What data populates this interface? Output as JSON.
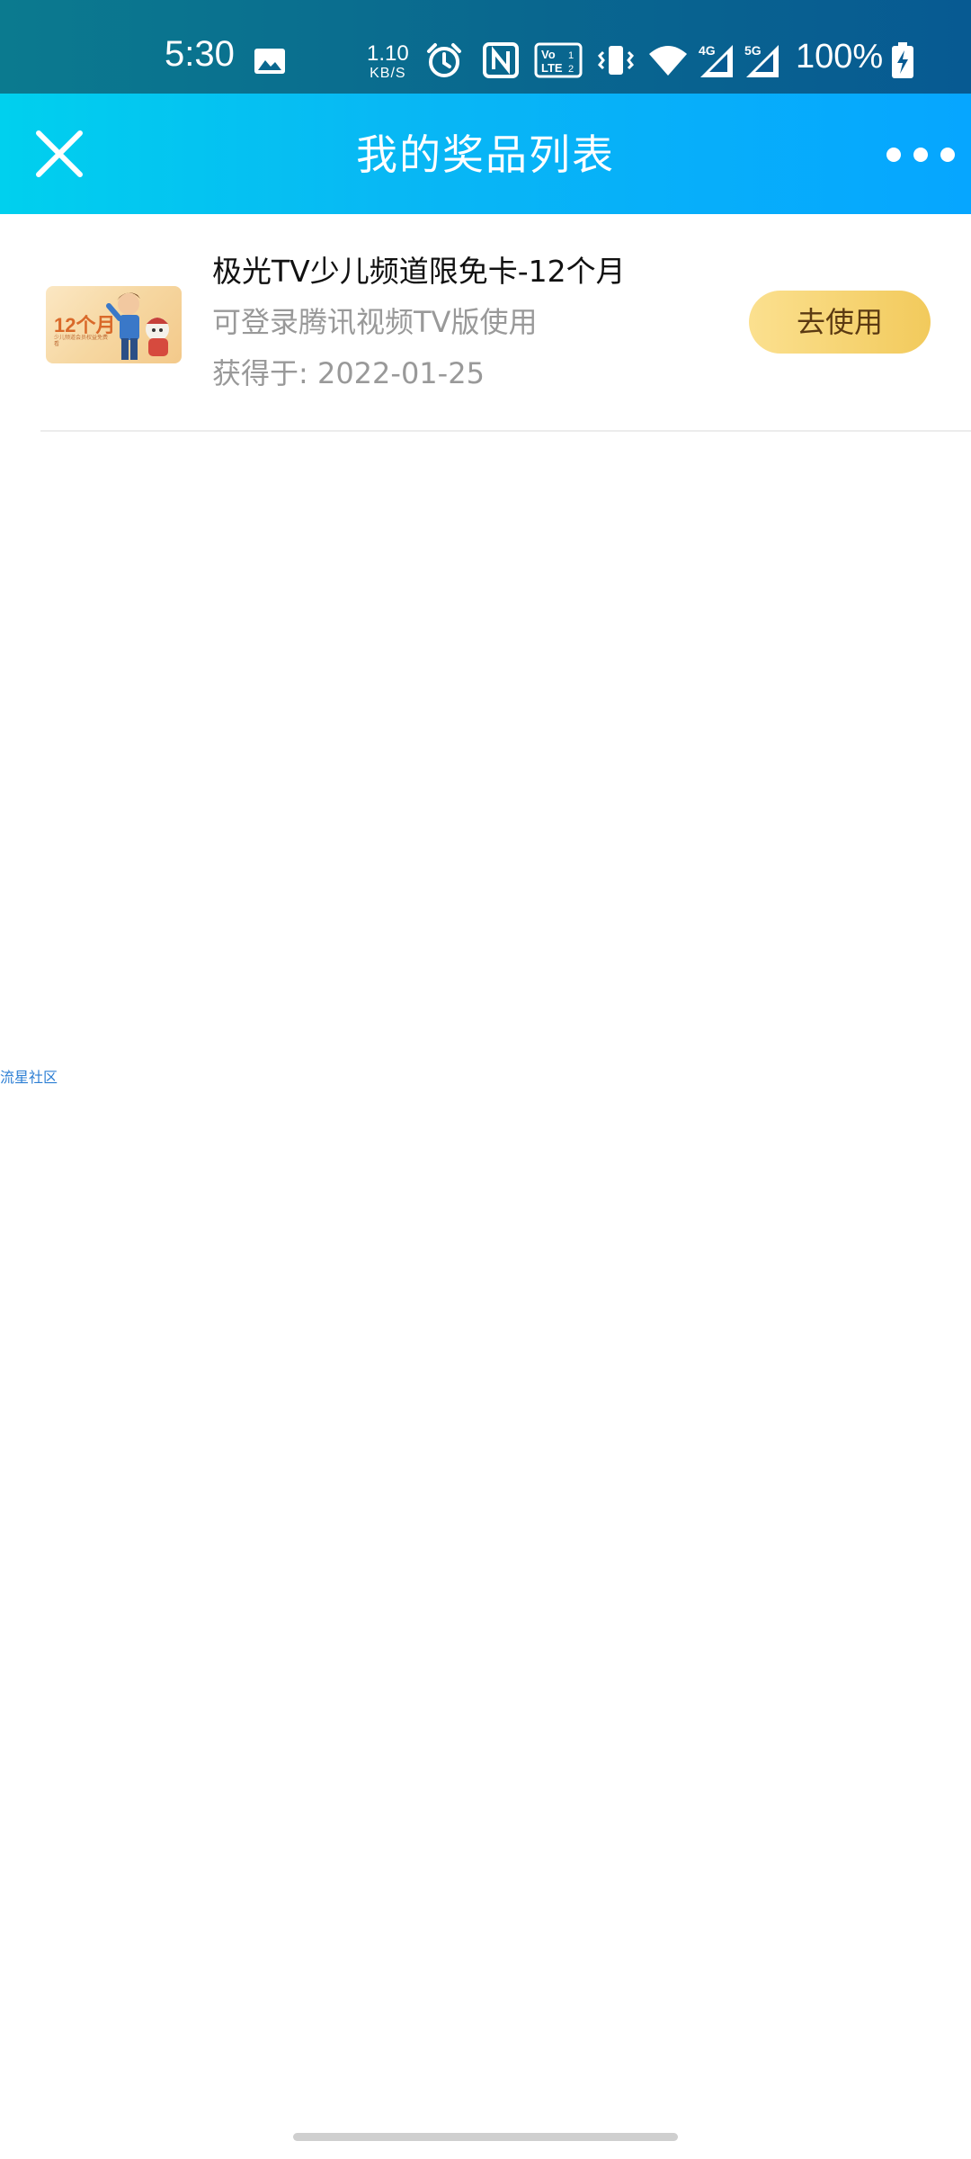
{
  "status_bar": {
    "time": "5:30",
    "net_speed_value": "1.10",
    "net_speed_unit": "KB/S",
    "battery": "100%",
    "icons": [
      "gallery-icon",
      "alarm-icon",
      "nfc-icon",
      "volte-icon",
      "vibrate-icon",
      "wifi-icon",
      "signal-4g-icon",
      "signal-5g-icon",
      "battery-charging-icon"
    ],
    "volte_label": "VoLTE 1 2",
    "lte_4g_label": "4G",
    "lte_5g_label": "5G"
  },
  "header": {
    "title": "我的奖品列表",
    "close_icon": "close-icon",
    "more_icon": "more-dots-icon"
  },
  "prize": {
    "name": "极光TV少儿频道限免卡-12个月",
    "description": "可登录腾讯视频TV版使用",
    "obtained_date": "获得于: 2022-01-25",
    "use_button": "去使用",
    "thumb_title": "12个月",
    "thumb_subtitle": "少儿频道会员权益免费看"
  },
  "watermark": "流星社区",
  "colors": {
    "status_bar": "#09678f",
    "header_start": "#00d0ee",
    "header_end": "#06a6ff",
    "button_start": "#fbe08f",
    "button_end": "#f2ca5c"
  }
}
